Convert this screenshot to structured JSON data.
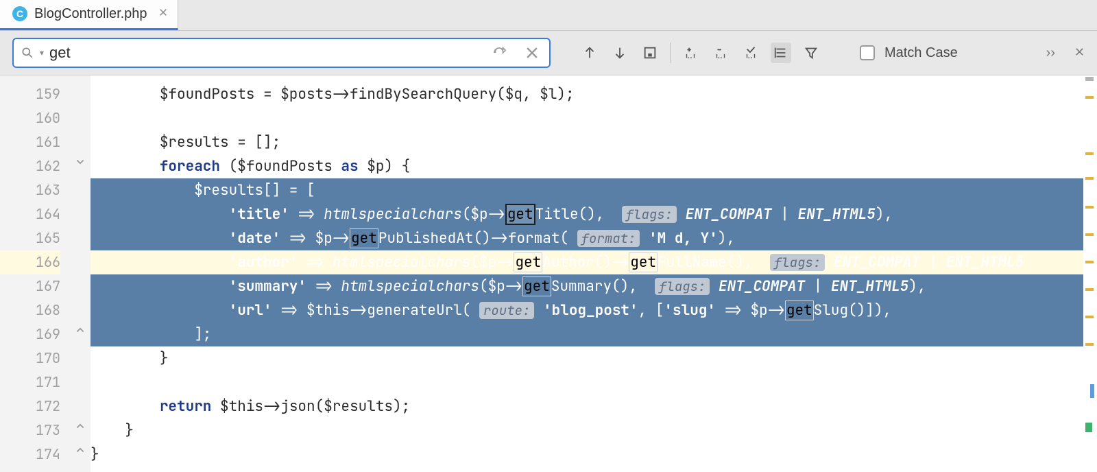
{
  "tab": {
    "icon_letter": "C",
    "filename": "BlogController.php"
  },
  "find": {
    "query": "get",
    "match_case_label": "Match Case"
  },
  "gutter": {
    "start": 159,
    "end": 174,
    "highlighted": 166
  },
  "code": {
    "l159_a": "$foundPosts = $posts->",
    "l159_fn": "findBySearchQuery",
    "l159_b": "($q, $l);",
    "l161": "$results = [];",
    "l162_a": "foreach",
    "l162_b": " ($foundPosts ",
    "l162_c": "as",
    "l162_d": " $p) {",
    "l163": "$results[] = [",
    "l164_k": "'title'",
    "l164_arrow": " => ",
    "l164_fn": "htmlspecialchars",
    "l164_a": "($p->",
    "l164_m": "get",
    "l164_b": "Title(),  ",
    "l164_h": "flags:",
    "l164_c1": " ENT_COMPAT",
    "l164_pipe": " | ",
    "l164_c2": "ENT_HTML5",
    "l164_end": "),",
    "l165_k": "'date'",
    "l165_a": " => $p->",
    "l165_m": "get",
    "l165_b": "PublishedAt()->format( ",
    "l165_h": "format:",
    "l165_s": " 'M d, Y'",
    "l165_end": "),",
    "l166_k": "'author'",
    "l166_a": " => ",
    "l166_fn": "htmlspecialchars",
    "l166_b": "($p->",
    "l166_m1": "get",
    "l166_c": "Author()->",
    "l166_m2": "get",
    "l166_d": "FullName(),  ",
    "l166_h": "flags:",
    "l166_c1": " ENT_COMPAT",
    "l166_pipe": " | ",
    "l166_c2": "ENT_HTML5",
    "l167_k": "'summary'",
    "l167_a": " => ",
    "l167_fn": "htmlspecialchars",
    "l167_b": "($p->",
    "l167_m": "get",
    "l167_c": "Summary(),  ",
    "l167_h": "flags:",
    "l167_c1": " ENT_COMPAT",
    "l167_pipe": " | ",
    "l167_c2": "ENT_HTML5",
    "l167_end": "),",
    "l168_k": "'url'",
    "l168_a": " => $this->generateUrl( ",
    "l168_h": "route:",
    "l168_s1": " 'blog_post'",
    "l168_b": ", [",
    "l168_s2": "'slug'",
    "l168_c": " => $p->",
    "l168_m": "get",
    "l168_d": "Slug()]),",
    "l169": "];",
    "l170": "}",
    "l172_a": "return",
    "l172_b": " $this->json($results);",
    "l173": "}",
    "l174": "}"
  }
}
